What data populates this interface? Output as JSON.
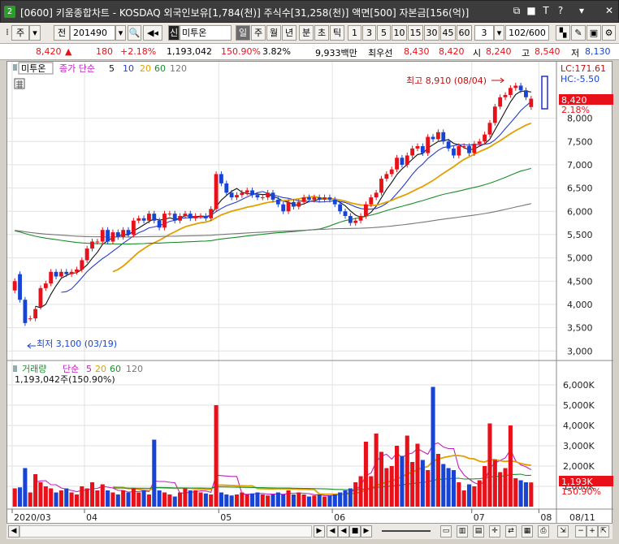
{
  "window": {
    "screen_no": "2",
    "title": "[0600] 키움종합차트 - KOSDAQ 외국인보유[1,784(천)] 주식수[31,258(천)] 액면[500] 자본금[156(억)]",
    "controls": [
      "⧉",
      "■",
      "T",
      "?",
      "▾",
      "✕"
    ]
  },
  "toolbar": {
    "market": "주",
    "prev_label": "전",
    "code": "201490",
    "stock_name": "미투온",
    "credit_badge": "신",
    "periods": [
      "일",
      "주",
      "월",
      "년",
      "분",
      "초",
      "틱"
    ],
    "minutes": [
      "1",
      "3",
      "5",
      "10",
      "15",
      "30",
      "45",
      "60"
    ],
    "minute_value": "3",
    "count": "102/600"
  },
  "quote": {
    "price": "8,420",
    "change": "180",
    "change_pct": "+2.18%",
    "volume": "1,193,042",
    "volume_pct": "150.90%",
    "turnover": "3.82%",
    "amount": "9,933백만",
    "pref_label": "최우선",
    "ask": "8,430",
    "bid": "8,420",
    "open_label": "시",
    "open": "8,240",
    "high_label": "고",
    "high": "8,540",
    "low_label": "저",
    "low": "8,130",
    "up_color": "#e8111a",
    "down_color": "#1844d6"
  },
  "price_panel": {
    "name_tag": "미투온",
    "legend_label": "종가 단순",
    "ma": [
      "5",
      "10",
      "20",
      "60",
      "120"
    ],
    "ma_colors": [
      "#111111",
      "#2a3dc8",
      "#e0a000",
      "#1a8f2a",
      "#777777"
    ],
    "max_label": "최고 8,910 (08/04)",
    "min_label": "최저 3,100 (03/19)",
    "lc": "LC:171.61",
    "hc": "HC:-5.50",
    "price_tag": "8,420",
    "pct_tag": "2.18%",
    "y_ticks": [
      "8,000",
      "7,500",
      "7,000",
      "6,500",
      "6,000",
      "5,500",
      "5,000",
      "4,500",
      "4,000",
      "3,500",
      "3,000"
    ]
  },
  "volume_panel": {
    "title": "거래량",
    "legend_label": "단순",
    "ma": [
      "5",
      "20",
      "60",
      "120"
    ],
    "volume_text": "1,193,042주(150.90%)",
    "y_ticks": [
      "6,000K",
      "5,000K",
      "4,000K",
      "3,000K",
      "2,000K",
      "1,000K"
    ],
    "vol_tag": "1,193K",
    "vol_pct_tag": "150.90%"
  },
  "x_axis": [
    "2020/03",
    "04",
    "05",
    "06",
    "07",
    "08",
    "08/11"
  ],
  "chart_data": {
    "type": "candlestick",
    "x_labels": [
      "2020/03",
      "04",
      "05",
      "06",
      "07",
      "08"
    ],
    "price_range": [
      2900,
      8900
    ],
    "close": [
      4500,
      4100,
      3600,
      3700,
      3900,
      4350,
      4450,
      4700,
      4600,
      4700,
      4650,
      4700,
      4750,
      4950,
      5200,
      5350,
      5350,
      5600,
      5350,
      5550,
      5450,
      5600,
      5500,
      5800,
      5850,
      5800,
      5950,
      5800,
      5650,
      5950,
      5950,
      5800,
      5900,
      5950,
      5850,
      5900,
      5900,
      5850,
      6050,
      6800,
      6600,
      6400,
      6300,
      6350,
      6400,
      6450,
      6350,
      6300,
      6300,
      6400,
      6250,
      6150,
      6000,
      6200,
      6100,
      6200,
      6300,
      6250,
      6300,
      6250,
      6300,
      6250,
      6150,
      6000,
      5900,
      5750,
      5800,
      5900,
      6150,
      6300,
      6400,
      6700,
      6800,
      6900,
      7150,
      7000,
      7200,
      7350,
      7400,
      7250,
      7600,
      7550,
      7700,
      7500,
      7350,
      7200,
      7400,
      7400,
      7250,
      7450,
      7500,
      7650,
      7900,
      8250,
      8450,
      8500,
      8650,
      8700,
      8600,
      8450,
      8420
    ],
    "open": [
      4300,
      4650,
      4100,
      3700,
      3700,
      3950,
      4350,
      4450,
      4700,
      4600,
      4700,
      4650,
      4700,
      4750,
      4950,
      5200,
      5350,
      5350,
      5600,
      5350,
      5550,
      5450,
      5600,
      5500,
      5800,
      5850,
      5800,
      5950,
      5800,
      5650,
      5950,
      5950,
      5800,
      5900,
      5950,
      5850,
      5900,
      5900,
      5850,
      6050,
      6800,
      6600,
      6400,
      6300,
      6350,
      6400,
      6450,
      6350,
      6300,
      6300,
      6400,
      6250,
      6150,
      6000,
      6200,
      6100,
      6200,
      6300,
      6250,
      6300,
      6250,
      6300,
      6250,
      6150,
      6000,
      5900,
      5750,
      5800,
      5900,
      6150,
      6300,
      6400,
      6700,
      6800,
      6900,
      7150,
      7000,
      7200,
      7350,
      7400,
      7250,
      7600,
      7550,
      7700,
      7500,
      7350,
      7200,
      7400,
      7400,
      7250,
      7450,
      7500,
      7650,
      7900,
      8250,
      8450,
      8500,
      8650,
      8700,
      8600,
      8240
    ],
    "volume_k": [
      900,
      950,
      1900,
      700,
      1600,
      1200,
      1000,
      900,
      700,
      800,
      900,
      700,
      600,
      1000,
      900,
      1200,
      800,
      1100,
      800,
      700,
      600,
      800,
      700,
      900,
      700,
      800,
      600,
      3300,
      800,
      700,
      600,
      500,
      700,
      900,
      800,
      800,
      700,
      650,
      600,
      5000,
      700,
      600,
      550,
      600,
      700,
      600,
      650,
      700,
      600,
      550,
      600,
      700,
      600,
      800,
      600,
      700,
      600,
      500,
      550,
      600,
      500,
      550,
      600,
      700,
      800,
      900,
      1200,
      1500,
      3200,
      1500,
      3600,
      2700,
      1900,
      2000,
      3000,
      2500,
      3500,
      2200,
      3100,
      2300,
      1800,
      5900,
      2600,
      2100,
      1900,
      1800,
      1200,
      800,
      1100,
      1000,
      1300,
      2000,
      4100,
      2300,
      1700,
      1900,
      4000,
      1400,
      1300,
      1200,
      1193
    ]
  }
}
